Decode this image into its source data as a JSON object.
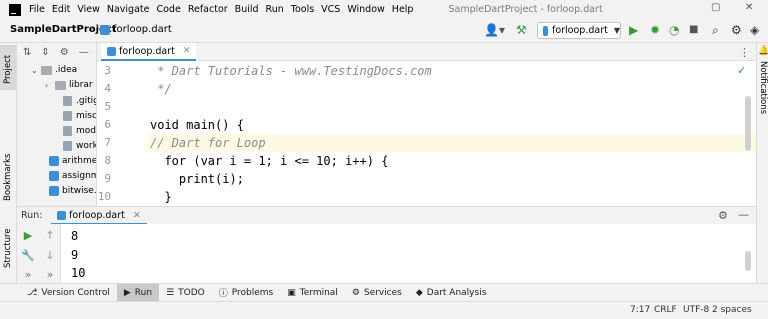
{
  "menu": {
    "items": [
      "File",
      "Edit",
      "View",
      "Navigate",
      "Code",
      "Refactor",
      "Build",
      "Run",
      "Tools",
      "VCS",
      "Window",
      "Help"
    ],
    "window_title": "SampleDartProject - forloop.dart"
  },
  "navbar": {
    "project": "SampleDartProject",
    "file": "forloop.dart",
    "run_config": "forloop.dart"
  },
  "left_stripe": {
    "project_label": "Project",
    "bookmarks_label": "Bookmarks",
    "structure_label": "Structure"
  },
  "right_stripe": {
    "notifications_label": "Notifications"
  },
  "project_tree": [
    {
      "label": ".idea",
      "type": "folder",
      "expanded": true
    },
    {
      "label": "librar",
      "type": "folder",
      "expanded": false
    },
    {
      "label": ".gitig",
      "type": "file"
    },
    {
      "label": "misc.",
      "type": "file"
    },
    {
      "label": "modu",
      "type": "file"
    },
    {
      "label": "work",
      "type": "file"
    },
    {
      "label": "arithmeti",
      "type": "dart"
    },
    {
      "label": "assignme",
      "type": "dart"
    },
    {
      "label": "bitwise.d",
      "type": "dart"
    }
  ],
  "editor": {
    "tab_label": "forloop.dart",
    "lines": [
      {
        "no": "3",
        "text": " * Dart Tutorials - www.TestingDocs.com"
      },
      {
        "no": "4",
        "text": " */"
      },
      {
        "no": "5",
        "text": ""
      },
      {
        "no": "6",
        "text": "void main() {"
      },
      {
        "no": "7",
        "text": "// Dart for Loop"
      },
      {
        "no": "8",
        "text": "  for (var i = 1; i <= 10; i++) {"
      },
      {
        "no": "9",
        "text": "    print(i);"
      },
      {
        "no": "10",
        "text": "  }"
      }
    ]
  },
  "run": {
    "title": "Run:",
    "tab_label": "forloop.dart",
    "output": [
      "8",
      "9",
      "10"
    ]
  },
  "bottom_tools": [
    {
      "label": "Version Control",
      "icon": "branch-icon"
    },
    {
      "label": "Run",
      "icon": "play-icon",
      "active": true
    },
    {
      "label": "TODO",
      "icon": "list-icon"
    },
    {
      "label": "Problems",
      "icon": "info-icon"
    },
    {
      "label": "Terminal",
      "icon": "terminal-icon"
    },
    {
      "label": "Services",
      "icon": "gear-icon"
    },
    {
      "label": "Dart Analysis",
      "icon": "dart-icon"
    }
  ],
  "status": {
    "position": "7:17",
    "line_ending": "CRLF",
    "encoding": "UTF-8",
    "indent": "2 spaces"
  }
}
